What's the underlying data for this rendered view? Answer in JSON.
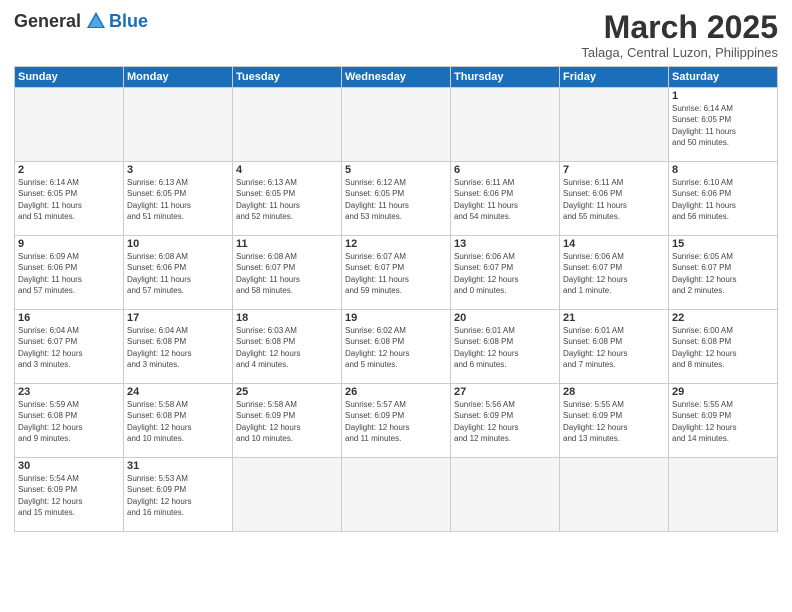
{
  "logo": {
    "general": "General",
    "blue": "Blue"
  },
  "title": "March 2025",
  "location": "Talaga, Central Luzon, Philippines",
  "weekdays": [
    "Sunday",
    "Monday",
    "Tuesday",
    "Wednesday",
    "Thursday",
    "Friday",
    "Saturday"
  ],
  "weeks": [
    [
      {
        "day": "",
        "info": ""
      },
      {
        "day": "",
        "info": ""
      },
      {
        "day": "",
        "info": ""
      },
      {
        "day": "",
        "info": ""
      },
      {
        "day": "",
        "info": ""
      },
      {
        "day": "",
        "info": ""
      },
      {
        "day": "1",
        "info": "Sunrise: 6:14 AM\nSunset: 6:05 PM\nDaylight: 11 hours\nand 50 minutes."
      }
    ],
    [
      {
        "day": "2",
        "info": "Sunrise: 6:14 AM\nSunset: 6:05 PM\nDaylight: 11 hours\nand 51 minutes."
      },
      {
        "day": "3",
        "info": "Sunrise: 6:13 AM\nSunset: 6:05 PM\nDaylight: 11 hours\nand 51 minutes."
      },
      {
        "day": "4",
        "info": "Sunrise: 6:13 AM\nSunset: 6:05 PM\nDaylight: 11 hours\nand 52 minutes."
      },
      {
        "day": "5",
        "info": "Sunrise: 6:12 AM\nSunset: 6:05 PM\nDaylight: 11 hours\nand 53 minutes."
      },
      {
        "day": "6",
        "info": "Sunrise: 6:11 AM\nSunset: 6:06 PM\nDaylight: 11 hours\nand 54 minutes."
      },
      {
        "day": "7",
        "info": "Sunrise: 6:11 AM\nSunset: 6:06 PM\nDaylight: 11 hours\nand 55 minutes."
      },
      {
        "day": "8",
        "info": "Sunrise: 6:10 AM\nSunset: 6:06 PM\nDaylight: 11 hours\nand 56 minutes."
      }
    ],
    [
      {
        "day": "9",
        "info": "Sunrise: 6:09 AM\nSunset: 6:06 PM\nDaylight: 11 hours\nand 57 minutes."
      },
      {
        "day": "10",
        "info": "Sunrise: 6:08 AM\nSunset: 6:06 PM\nDaylight: 11 hours\nand 57 minutes."
      },
      {
        "day": "11",
        "info": "Sunrise: 6:08 AM\nSunset: 6:07 PM\nDaylight: 11 hours\nand 58 minutes."
      },
      {
        "day": "12",
        "info": "Sunrise: 6:07 AM\nSunset: 6:07 PM\nDaylight: 11 hours\nand 59 minutes."
      },
      {
        "day": "13",
        "info": "Sunrise: 6:06 AM\nSunset: 6:07 PM\nDaylight: 12 hours\nand 0 minutes."
      },
      {
        "day": "14",
        "info": "Sunrise: 6:06 AM\nSunset: 6:07 PM\nDaylight: 12 hours\nand 1 minute."
      },
      {
        "day": "15",
        "info": "Sunrise: 6:05 AM\nSunset: 6:07 PM\nDaylight: 12 hours\nand 2 minutes."
      }
    ],
    [
      {
        "day": "16",
        "info": "Sunrise: 6:04 AM\nSunset: 6:07 PM\nDaylight: 12 hours\nand 3 minutes."
      },
      {
        "day": "17",
        "info": "Sunrise: 6:04 AM\nSunset: 6:08 PM\nDaylight: 12 hours\nand 3 minutes."
      },
      {
        "day": "18",
        "info": "Sunrise: 6:03 AM\nSunset: 6:08 PM\nDaylight: 12 hours\nand 4 minutes."
      },
      {
        "day": "19",
        "info": "Sunrise: 6:02 AM\nSunset: 6:08 PM\nDaylight: 12 hours\nand 5 minutes."
      },
      {
        "day": "20",
        "info": "Sunrise: 6:01 AM\nSunset: 6:08 PM\nDaylight: 12 hours\nand 6 minutes."
      },
      {
        "day": "21",
        "info": "Sunrise: 6:01 AM\nSunset: 6:08 PM\nDaylight: 12 hours\nand 7 minutes."
      },
      {
        "day": "22",
        "info": "Sunrise: 6:00 AM\nSunset: 6:08 PM\nDaylight: 12 hours\nand 8 minutes."
      }
    ],
    [
      {
        "day": "23",
        "info": "Sunrise: 5:59 AM\nSunset: 6:08 PM\nDaylight: 12 hours\nand 9 minutes."
      },
      {
        "day": "24",
        "info": "Sunrise: 5:58 AM\nSunset: 6:08 PM\nDaylight: 12 hours\nand 10 minutes."
      },
      {
        "day": "25",
        "info": "Sunrise: 5:58 AM\nSunset: 6:09 PM\nDaylight: 12 hours\nand 10 minutes."
      },
      {
        "day": "26",
        "info": "Sunrise: 5:57 AM\nSunset: 6:09 PM\nDaylight: 12 hours\nand 11 minutes."
      },
      {
        "day": "27",
        "info": "Sunrise: 5:56 AM\nSunset: 6:09 PM\nDaylight: 12 hours\nand 12 minutes."
      },
      {
        "day": "28",
        "info": "Sunrise: 5:55 AM\nSunset: 6:09 PM\nDaylight: 12 hours\nand 13 minutes."
      },
      {
        "day": "29",
        "info": "Sunrise: 5:55 AM\nSunset: 6:09 PM\nDaylight: 12 hours\nand 14 minutes."
      }
    ],
    [
      {
        "day": "30",
        "info": "Sunrise: 5:54 AM\nSunset: 6:09 PM\nDaylight: 12 hours\nand 15 minutes."
      },
      {
        "day": "31",
        "info": "Sunrise: 5:53 AM\nSunset: 6:09 PM\nDaylight: 12 hours\nand 16 minutes."
      },
      {
        "day": "",
        "info": ""
      },
      {
        "day": "",
        "info": ""
      },
      {
        "day": "",
        "info": ""
      },
      {
        "day": "",
        "info": ""
      },
      {
        "day": "",
        "info": ""
      }
    ]
  ]
}
